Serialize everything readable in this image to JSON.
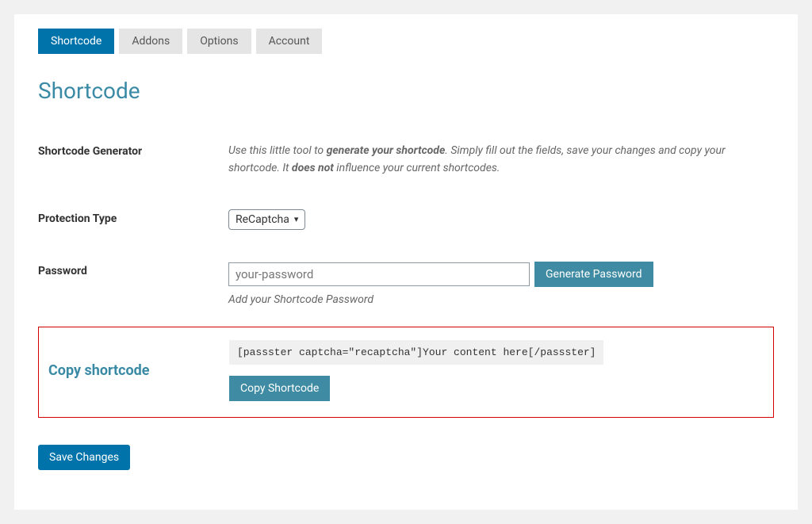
{
  "tabs": {
    "shortcode": "Shortcode",
    "addons": "Addons",
    "options": "Options",
    "account": "Account"
  },
  "page_title": "Shortcode",
  "generator": {
    "label": "Shortcode Generator",
    "desc_prefix": "Use this little tool to ",
    "desc_bold1": "generate your shortcode",
    "desc_mid": ". Simply fill out the fields, save your changes and copy your shortcode. It ",
    "desc_bold2": "does not",
    "desc_suffix": " influence your current shortcodes."
  },
  "protection": {
    "label": "Protection Type",
    "value": "ReCaptcha"
  },
  "password": {
    "label": "Password",
    "placeholder": "your-password",
    "generate_btn": "Generate Password",
    "hint": "Add your Shortcode Password"
  },
  "copy": {
    "label": "Copy shortcode",
    "code": "[passster captcha=\"recaptcha\"]Your content here[/passster]",
    "btn": "Copy Shortcode"
  },
  "save_btn": "Save Changes"
}
